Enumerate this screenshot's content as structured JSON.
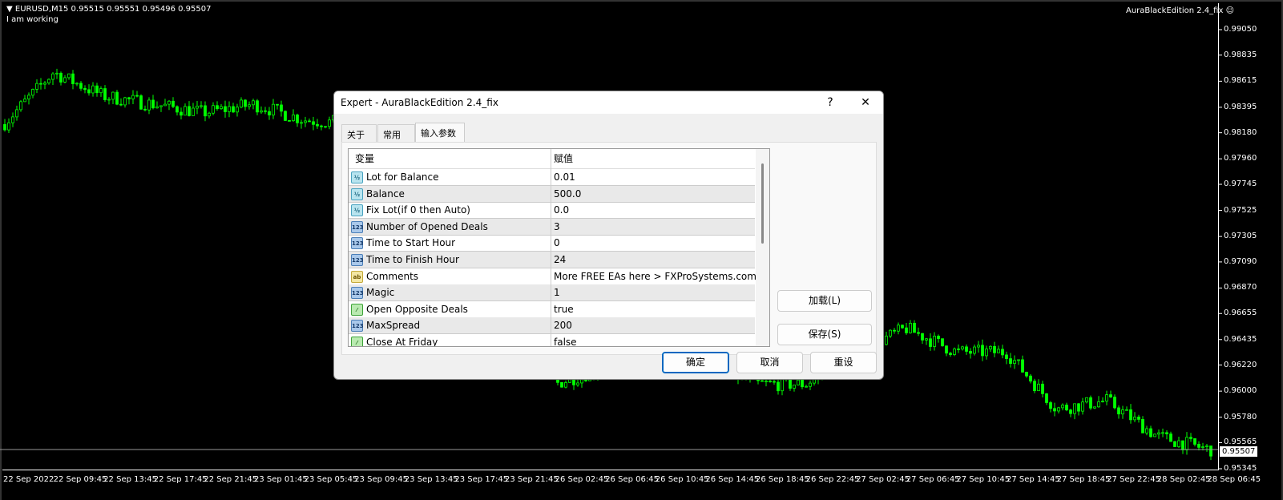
{
  "chart": {
    "header": "EURUSD,M15  0.95515 0.95551 0.95496 0.95507",
    "status": "I am working",
    "expert_label": "AuraBlackEdition 2.4_fix",
    "expert_icon": "smiley-face-icon",
    "candle_color": "#00ff00",
    "background": "#000000"
  },
  "chart_data": {
    "type": "candlestick",
    "symbol": "EURUSD",
    "timeframe": "M15",
    "last_bar": {
      "open": 0.95515,
      "high": 0.95551,
      "low": 0.95496,
      "close": 0.95507
    },
    "bid_line": "0.95507",
    "ylim": [
      0.95345,
      0.9905
    ],
    "y_ticks": [
      "0.99050",
      "0.98835",
      "0.98615",
      "0.98395",
      "0.98180",
      "0.97960",
      "0.97745",
      "0.97525",
      "0.97305",
      "0.97090",
      "0.96870",
      "0.96655",
      "0.96435",
      "0.96220",
      "0.96000",
      "0.95780",
      "0.95565",
      "0.95345"
    ],
    "x_ticks": [
      "22 Sep 2022",
      "22 Sep 09:45",
      "22 Sep 13:45",
      "22 Sep 17:45",
      "22 Sep 21:45",
      "23 Sep 01:45",
      "23 Sep 05:45",
      "23 Sep 09:45",
      "23 Sep 13:45",
      "23 Sep 17:45",
      "23 Sep 21:45",
      "26 Sep 02:45",
      "26 Sep 06:45",
      "26 Sep 10:45",
      "26 Sep 14:45",
      "26 Sep 18:45",
      "26 Sep 22:45",
      "27 Sep 02:45",
      "27 Sep 06:45",
      "27 Sep 10:45",
      "27 Sep 14:45",
      "27 Sep 18:45",
      "27 Sep 22:45",
      "28 Sep 02:45",
      "28 Sep 06:45"
    ],
    "approx_close_at_ticks": [
      0.9825,
      0.9869,
      0.9849,
      0.9842,
      0.9835,
      0.9842,
      0.9829,
      0.9825,
      0.9815,
      0.98,
      0.976,
      0.9606,
      0.962,
      0.9625,
      0.9625,
      0.9606,
      0.9606,
      0.9633,
      0.9653,
      0.9633,
      0.9633,
      0.9585,
      0.9592,
      0.9562,
      0.9551
    ]
  },
  "dialog": {
    "title": "Expert - AuraBlackEdition 2.4_fix",
    "help_label": "?",
    "close_label": "✕",
    "tabs": [
      {
        "label": "关于"
      },
      {
        "label": "常用"
      },
      {
        "label": "输入参数",
        "active": true
      }
    ],
    "columns": [
      "变量",
      "赋值"
    ],
    "params": [
      {
        "type": "double",
        "icon": "double-type-icon",
        "badge": "½",
        "name": "Lot for Balance",
        "value": "0.01"
      },
      {
        "type": "double",
        "icon": "double-type-icon",
        "badge": "½",
        "name": "Balance",
        "value": "500.0"
      },
      {
        "type": "double",
        "icon": "double-type-icon",
        "badge": "½",
        "name": "Fix Lot(if 0 then Auto)",
        "value": "0.0"
      },
      {
        "type": "int",
        "icon": "integer-type-icon",
        "badge": "123",
        "name": "Number of Opened Deals",
        "value": "3"
      },
      {
        "type": "int",
        "icon": "integer-type-icon",
        "badge": "123",
        "name": "Time to Start Hour",
        "value": "0"
      },
      {
        "type": "int",
        "icon": "integer-type-icon",
        "badge": "123",
        "name": "Time to Finish Hour",
        "value": "24"
      },
      {
        "type": "string",
        "icon": "string-type-icon",
        "badge": "ab",
        "name": "Comments",
        "value": "More FREE EAs here > FXProSystems.com"
      },
      {
        "type": "int",
        "icon": "integer-type-icon",
        "badge": "123",
        "name": "Magic",
        "value": "1"
      },
      {
        "type": "bool",
        "icon": "boolean-type-icon",
        "badge": "⁄",
        "name": "Open Opposite Deals",
        "value": "true"
      },
      {
        "type": "int",
        "icon": "integer-type-icon",
        "badge": "123",
        "name": "MaxSpread",
        "value": "200"
      },
      {
        "type": "bool",
        "icon": "boolean-type-icon",
        "badge": "⁄",
        "name": "Close At Friday",
        "value": "false"
      }
    ],
    "buttons": {
      "load": "加载(L)",
      "save": "保存(S)",
      "ok": "确定",
      "cancel": "取消",
      "reset": "重设"
    }
  }
}
